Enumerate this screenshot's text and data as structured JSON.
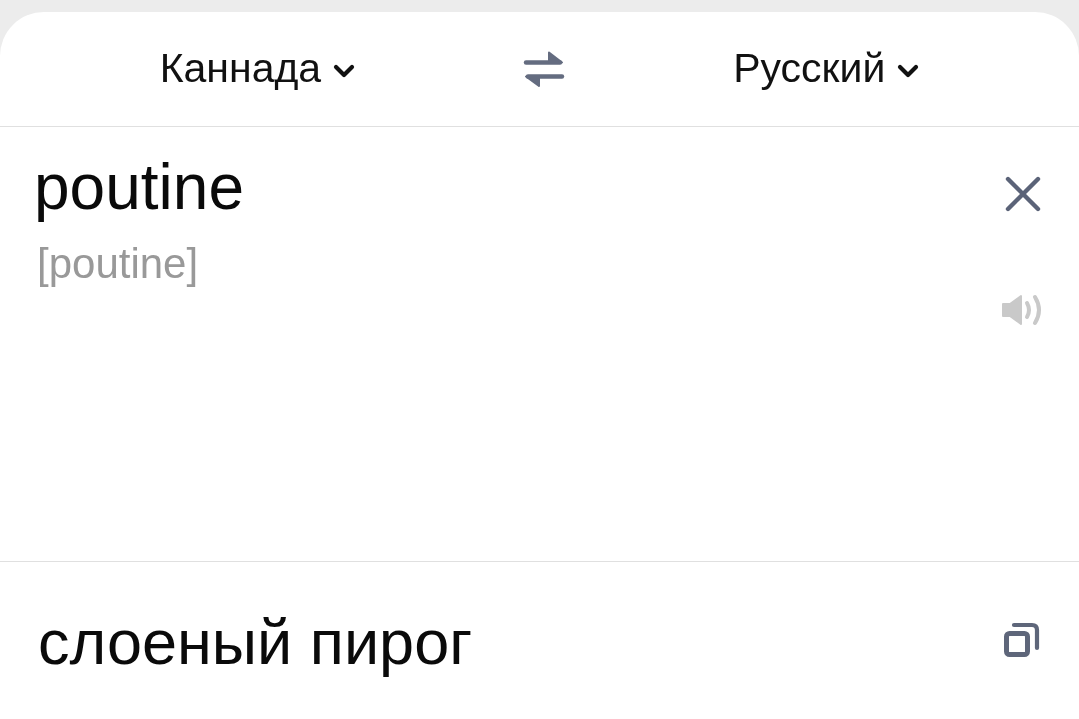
{
  "header": {
    "source_language": {
      "label": "Каннада"
    },
    "target_language": {
      "label": "Русский"
    }
  },
  "source": {
    "value": "poutine",
    "transliteration": "[poutine]",
    "speak_button": {
      "disabled": true
    }
  },
  "translation": {
    "text": "слоеный пирог"
  }
}
